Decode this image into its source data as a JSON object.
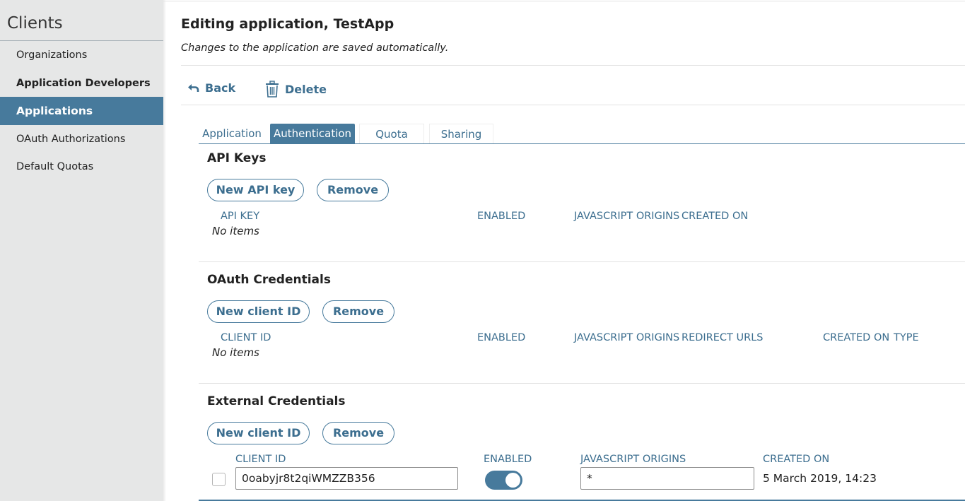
{
  "colors": {
    "accent": "#477a9c",
    "link": "#3c6e8f",
    "sidebar_bg": "#e6e7e7"
  },
  "sidebar": {
    "title": "Clients",
    "items": [
      {
        "label": "Organizations"
      },
      {
        "label": "Application Developers"
      },
      {
        "label": "Applications",
        "active": true
      },
      {
        "label": "OAuth Authorizations"
      },
      {
        "label": "Default Quotas"
      }
    ]
  },
  "header": {
    "title": "Editing application, TestApp",
    "subtitle": "Changes to the application are saved automatically."
  },
  "toolbar": {
    "back_label": "Back",
    "back_icon": "back-arrow-icon",
    "delete_label": "Delete",
    "delete_icon": "trash-icon"
  },
  "tabs": [
    {
      "label": "Application"
    },
    {
      "label": "Authentication",
      "active": true
    },
    {
      "label": "Quota"
    },
    {
      "label": "Sharing"
    }
  ],
  "api_keys": {
    "title": "API Keys",
    "new_button": "New API key",
    "remove_button": "Remove",
    "columns": [
      "API KEY",
      "ENABLED",
      "JAVASCRIPT ORIGINS",
      "CREATED ON"
    ],
    "empty_text": "No items"
  },
  "oauth": {
    "title": "OAuth Credentials",
    "new_button": "New client ID",
    "remove_button": "Remove",
    "columns": [
      "CLIENT ID",
      "ENABLED",
      "JAVASCRIPT ORIGINS",
      "REDIRECT URLS",
      "CREATED ON",
      "TYPE"
    ],
    "empty_text": "No items"
  },
  "external": {
    "title": "External Credentials",
    "new_button": "New client ID",
    "remove_button": "Remove",
    "columns": [
      "CLIENT ID",
      "ENABLED",
      "JAVASCRIPT ORIGINS",
      "CREATED ON"
    ],
    "rows": [
      {
        "selected": false,
        "client_id": "0oabyjr8t2qiWMZZB356",
        "enabled": true,
        "javascript_origins": "*",
        "created_on": "5 March 2019, 14:23"
      }
    ]
  }
}
